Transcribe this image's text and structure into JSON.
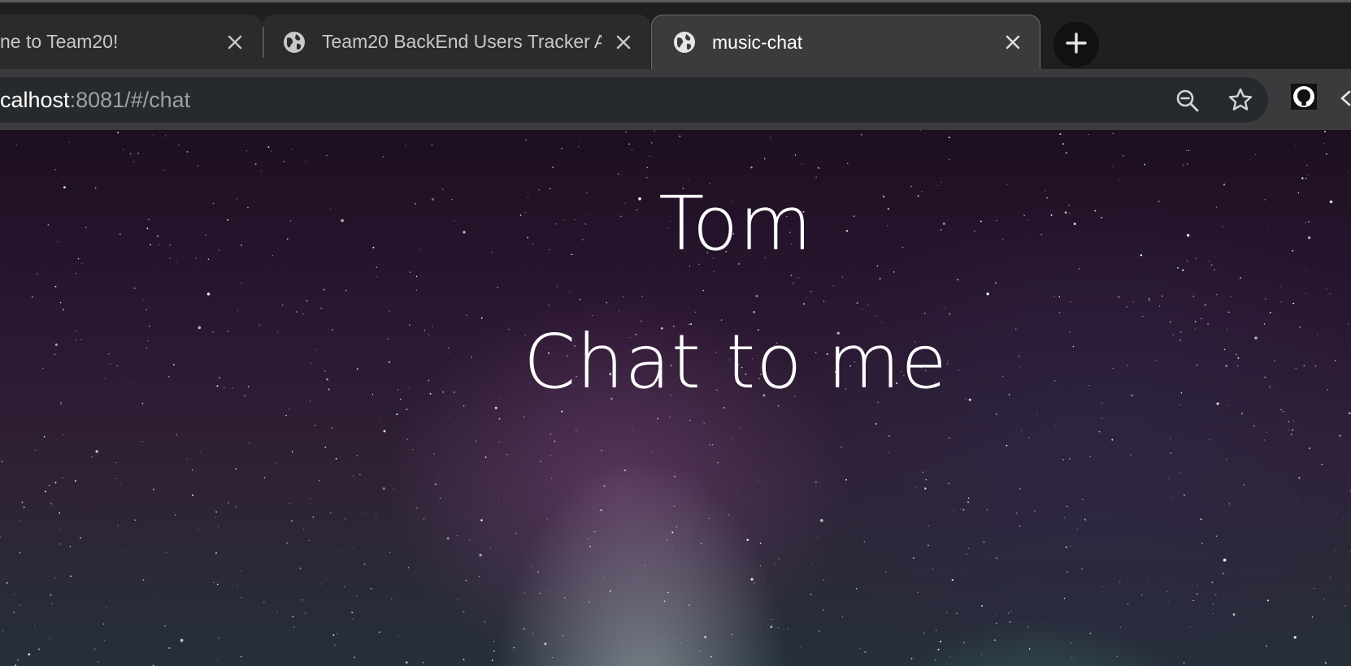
{
  "tabs": [
    {
      "title": "ne to Team20!",
      "favicon": "none",
      "active": false
    },
    {
      "title": "Team20 BackEnd Users Tracker A",
      "favicon": "globe-icon",
      "active": false
    },
    {
      "title": "music-chat",
      "favicon": "globe-icon",
      "active": true
    }
  ],
  "toolbar": {
    "url_host": "calhost",
    "url_rest": ":8081/#/chat",
    "icons": [
      "zoom-out-icon",
      "star-icon",
      "github-icon"
    ]
  },
  "page": {
    "name": "Tom",
    "cta": "Chat to me"
  },
  "colors": {
    "tab_bg": "#2b2b2d",
    "active_tab_bg": "#3b3b3d",
    "omnibox_bg": "#272a2d",
    "text": "#ffffff"
  }
}
